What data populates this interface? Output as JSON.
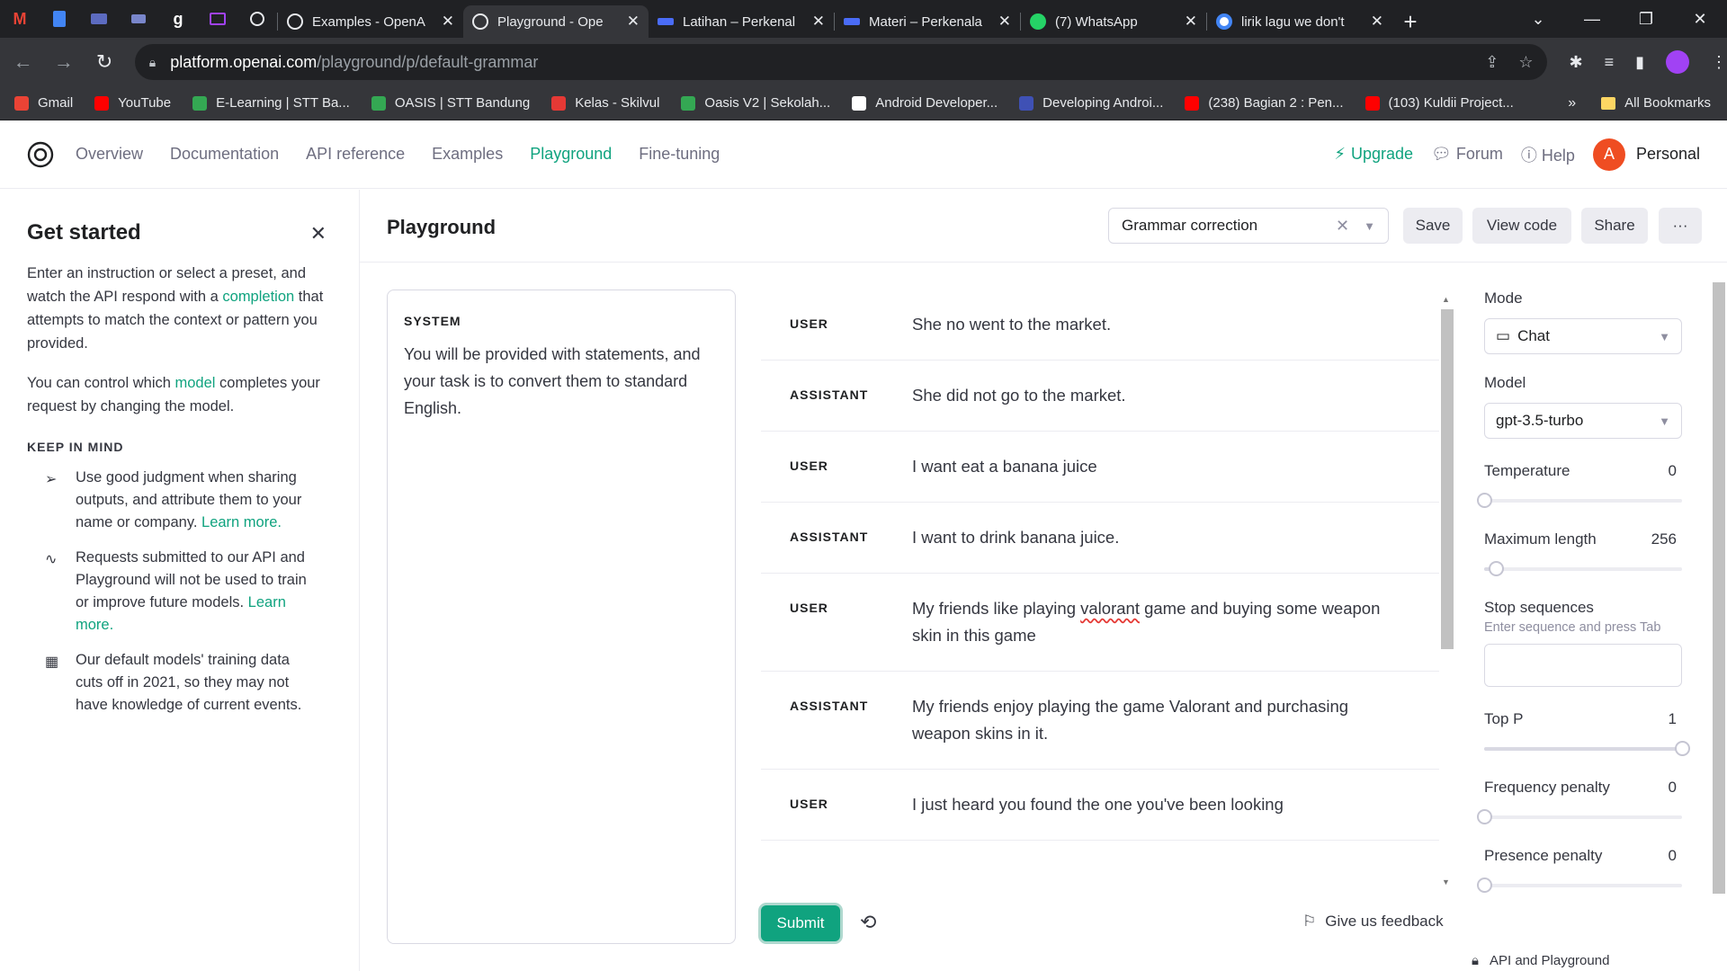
{
  "browser": {
    "tabs": [
      {
        "title": "Examples - OpenA",
        "color": "#e8eaed",
        "active": false
      },
      {
        "title": "Playground - Ope",
        "color": "#e8eaed",
        "active": true
      },
      {
        "title": "Latihan – Perkenal",
        "color": "#4a6cf7",
        "active": false
      },
      {
        "title": "Materi – Perkenala",
        "color": "#4a6cf7",
        "active": false
      },
      {
        "title": "(7) WhatsApp",
        "color": "#25d366",
        "active": false
      },
      {
        "title": "lirik lagu we don't",
        "color": "#4285f4",
        "active": false
      }
    ],
    "url_host": "platform.openai.com",
    "url_path": "/playground/p/default-grammar",
    "bookmarks": [
      {
        "label": "Gmail",
        "color": "#ea4335"
      },
      {
        "label": "YouTube",
        "color": "#ff0000"
      },
      {
        "label": "E-Learning | STT Ba...",
        "color": "#34a853"
      },
      {
        "label": "OASIS | STT Bandung",
        "color": "#34a853"
      },
      {
        "label": "Kelas - Skilvul",
        "color": "#e53935"
      },
      {
        "label": "Oasis V2 | Sekolah...",
        "color": "#34a853"
      },
      {
        "label": "Android Developer...",
        "color": "#ffffff"
      },
      {
        "label": "Developing Androi...",
        "color": "#3f51b5"
      },
      {
        "label": "(238) Bagian 2 : Pen...",
        "color": "#ff0000"
      },
      {
        "label": "(103) Kuldii Project...",
        "color": "#ff0000"
      }
    ],
    "all_bookmarks": "All Bookmarks"
  },
  "nav": {
    "links": [
      "Overview",
      "Documentation",
      "API reference",
      "Examples",
      "Playground",
      "Fine-tuning"
    ],
    "upgrade": "Upgrade",
    "forum": "Forum",
    "help": "Help",
    "avatar_letter": "A",
    "account": "Personal"
  },
  "sidebar": {
    "title": "Get started",
    "p1_before": "Enter an instruction or select a preset, and watch the API respond with a ",
    "p1_link": "completion",
    "p1_after": " that attempts to match the context or pattern you provided.",
    "p2_before": "You can control which ",
    "p2_link": "model",
    "p2_after": " completes your request by changing the model.",
    "keep_heading": "KEEP IN MIND",
    "tips": [
      {
        "text": "Use good judgment when sharing outputs, and attribute them to your name or company. ",
        "link": "Learn more."
      },
      {
        "text": "Requests submitted to our API and Playground will not be used to train or improve future models. ",
        "link": "Learn more."
      },
      {
        "text": "Our default models' training data cuts off in 2021, so they may not have knowledge of current events.",
        "link": ""
      }
    ]
  },
  "header": {
    "title": "Playground",
    "preset": "Grammar correction",
    "save": "Save",
    "view_code": "View code",
    "share": "Share",
    "more": "···"
  },
  "system": {
    "label": "SYSTEM",
    "text": "You will be provided with statements, and your task is to convert them to standard English."
  },
  "messages": [
    {
      "role": "USER",
      "text": "She no went to the market."
    },
    {
      "role": "ASSISTANT",
      "text": "She did not go to the market."
    },
    {
      "role": "USER",
      "text": "I want eat a banana juice"
    },
    {
      "role": "ASSISTANT",
      "text": "I want to drink banana juice."
    },
    {
      "role": "USER",
      "text_before": "My friends like playing ",
      "text_flag": "valorant",
      "text_after": " game and buying some weapon skin in this game"
    },
    {
      "role": "ASSISTANT",
      "text": "My friends enjoy playing the game Valorant and purchasing weapon skins in it."
    },
    {
      "role": "USER",
      "text": "I just heard you found the one you've been looking"
    }
  ],
  "footer": {
    "submit": "Submit",
    "feedback": "Give us feedback",
    "api_note": "API and Playground"
  },
  "settings": {
    "mode_label": "Mode",
    "mode_value": "Chat",
    "model_label": "Model",
    "model_value": "gpt-3.5-turbo",
    "temperature_label": "Temperature",
    "temperature": "0",
    "max_length_label": "Maximum length",
    "max_length": "256",
    "stop_label": "Stop sequences",
    "stop_hint": "Enter sequence and press Tab",
    "top_p_label": "Top P",
    "top_p": "1",
    "freq_label": "Frequency penalty",
    "freq": "0",
    "presence_label": "Presence penalty",
    "presence": "0",
    "slider_levels": {
      "temperature": 0,
      "max_length": 0.06,
      "top_p": 1,
      "freq": 0,
      "presence": 0
    }
  },
  "colors": {
    "accent": "#10a37f",
    "avatar": "#ef4d22"
  }
}
